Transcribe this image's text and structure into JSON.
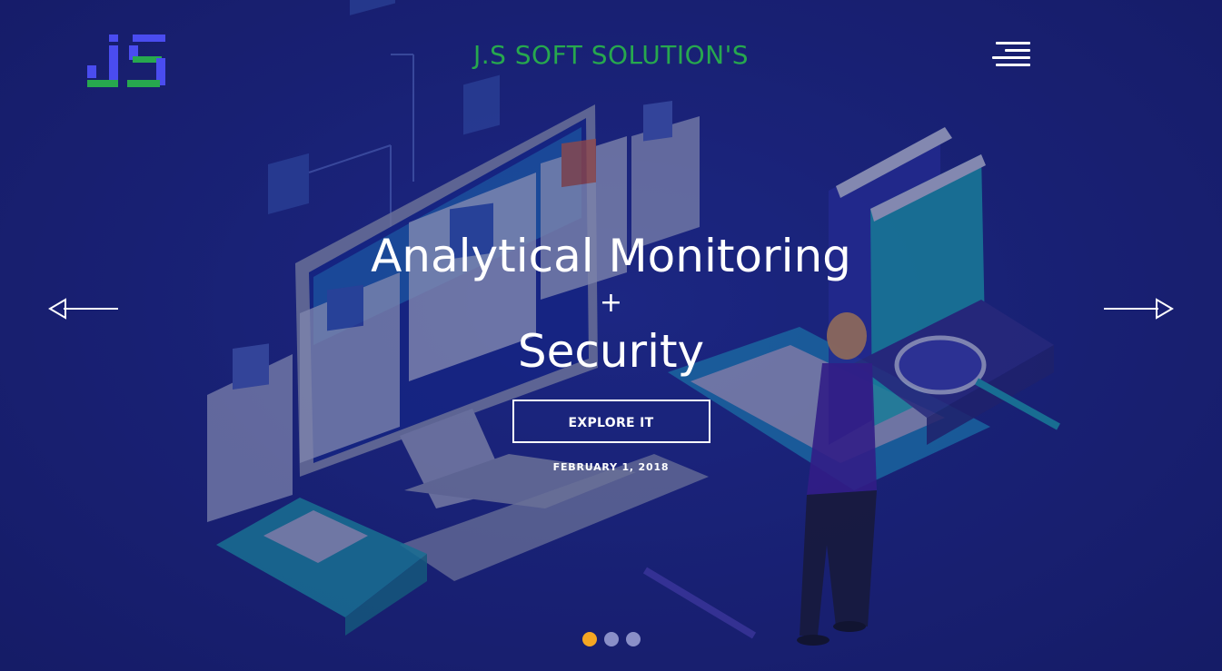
{
  "brand": {
    "title": "J.S SOFT SOLUTION'S",
    "title_color": "#27a84e",
    "logo_text": "JS",
    "logo_colors": {
      "green": "#27a84e",
      "blue": "#4a4cf0"
    }
  },
  "nav": {
    "menu_icon": "hamburger-menu-icon",
    "prev_icon": "arrow-left-icon",
    "next_icon": "arrow-right-icon"
  },
  "slide": {
    "headline_line1": "Analytical Monitoring",
    "headline_plus": "+",
    "headline_line2": "Security",
    "button_label": "EXPLORE IT",
    "date": "FEBRUARY 1, 2018"
  },
  "carousel": {
    "slide_count": 3,
    "active_index": 0,
    "active_color": "#f5a623",
    "inactive_color": "#8a8fc8"
  },
  "colors": {
    "background": "#1a2275"
  }
}
